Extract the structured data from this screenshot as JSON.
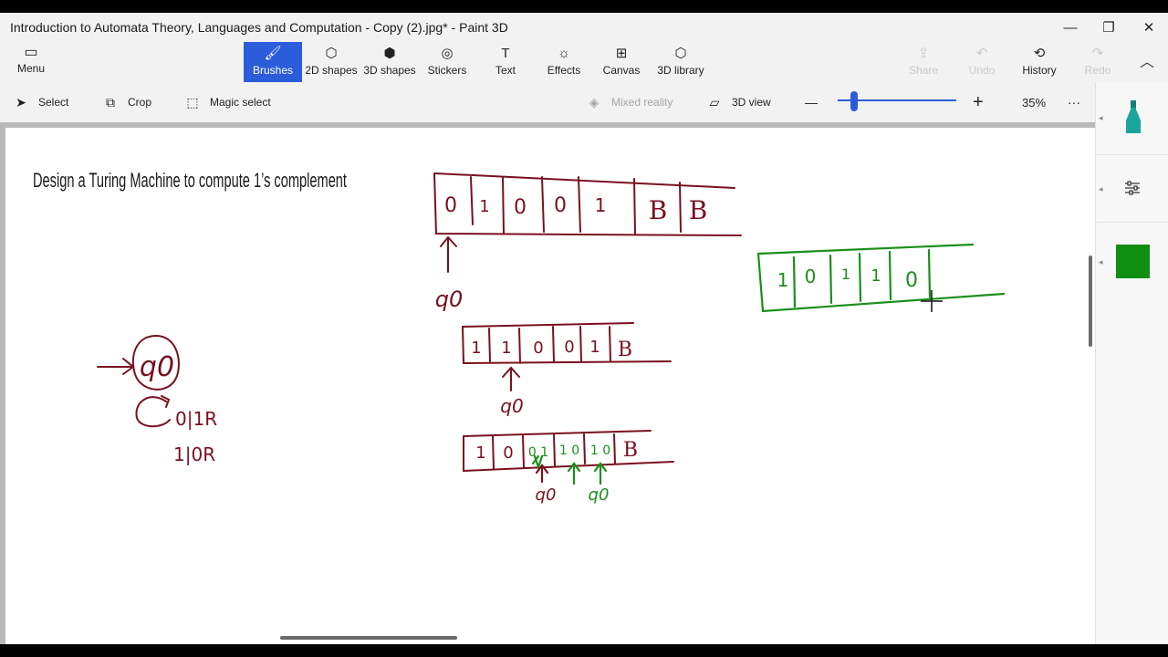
{
  "window": {
    "title": "Introduction to Automata Theory, Languages and Computation - Copy (2).jpg* - Paint 3D",
    "minimize": "—",
    "restore": "❐",
    "close": "✕"
  },
  "ribbon": {
    "menu": {
      "label": "Menu",
      "icon": "▭"
    },
    "tools": [
      {
        "label": "Brushes",
        "icon": "🖌"
      },
      {
        "label": "2D shapes",
        "icon": "⬡"
      },
      {
        "label": "3D shapes",
        "icon": "⬢"
      },
      {
        "label": "Stickers",
        "icon": "◎"
      },
      {
        "label": "Text",
        "icon": "T"
      },
      {
        "label": "Effects",
        "icon": "☼"
      },
      {
        "label": "Canvas",
        "icon": "⊞"
      },
      {
        "label": "3D library",
        "icon": "⬡"
      }
    ],
    "share": {
      "label": "Share",
      "icon": "⇪"
    },
    "undo": {
      "label": "Undo",
      "icon": "↶"
    },
    "history": {
      "label": "History",
      "icon": "⟲"
    },
    "redo": {
      "label": "Redo",
      "icon": "↷"
    },
    "collapse_icon": "︿"
  },
  "subbar": {
    "select": {
      "label": "Select",
      "icon": "➤"
    },
    "crop": {
      "label": "Crop",
      "icon": "⧉"
    },
    "magic_select": {
      "label": "Magic select",
      "icon": "⬚"
    },
    "mixed_reality": {
      "label": "Mixed reality",
      "icon": "◈"
    },
    "view3d": {
      "label": "3D view",
      "icon": "▱"
    },
    "zoom_out": "—",
    "zoom_in": "+",
    "zoom_value": "35%",
    "zoom_fraction": 0.12,
    "more": "···"
  },
  "canvas": {
    "heading": "Design a Turing Machine to compute 1’s complement",
    "tape1": [
      "0",
      "1",
      "0",
      "0",
      "1",
      "B",
      "B"
    ],
    "tape1_head": "q0",
    "state_label": "q0",
    "transitions": [
      "0|1R",
      "1|0R"
    ],
    "tape2": [
      "1",
      "1",
      "0",
      "0",
      "1",
      "B"
    ],
    "tape2_head": "q0",
    "tape3": [
      "1",
      "0",
      "0 1",
      "1 0",
      "1 0",
      "B"
    ],
    "tape3_heads": [
      "q0",
      "q0"
    ],
    "green_tape": [
      "1",
      "0",
      "1",
      "1",
      "0"
    ]
  },
  "right_panel": {
    "brush_icon": "marker-icon",
    "settings_icon": "sliders-icon",
    "color": "#108f10"
  },
  "colors": {
    "ink_red": "#7a1020",
    "ink_green": "#1a8f1a",
    "accent": "#2b5cd9"
  }
}
